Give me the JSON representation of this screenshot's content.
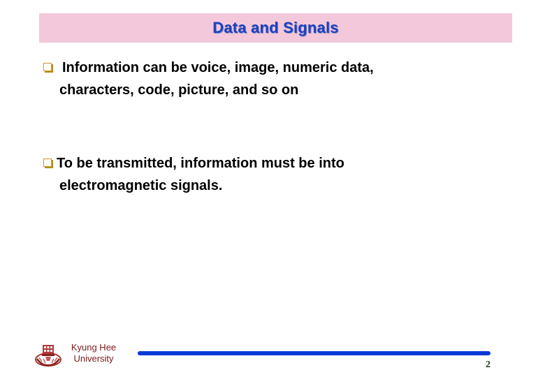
{
  "slide": {
    "title": "Data and Signals",
    "bullets": [
      {
        "icon": "checkbox-square-icon",
        "lines": [
          "Information can be voice, image, numeric data,",
          "characters, code, picture, and so on"
        ]
      },
      {
        "icon": "checkbox-square-icon",
        "lines": [
          "To be transmitted, information must be into",
          "electromagnetic signals."
        ]
      }
    ]
  },
  "footer": {
    "logo_icon": "university-crest-icon",
    "institution_line1": "Kyung Hee",
    "institution_line2": "University",
    "page_number": "2"
  },
  "colors": {
    "title_background": "#f2c8da",
    "title_text": "#1f3fc0",
    "footer_rule": "#0a3ad6",
    "institution_text": "#7a1a1a",
    "bullet_icon": "#c89a34"
  }
}
